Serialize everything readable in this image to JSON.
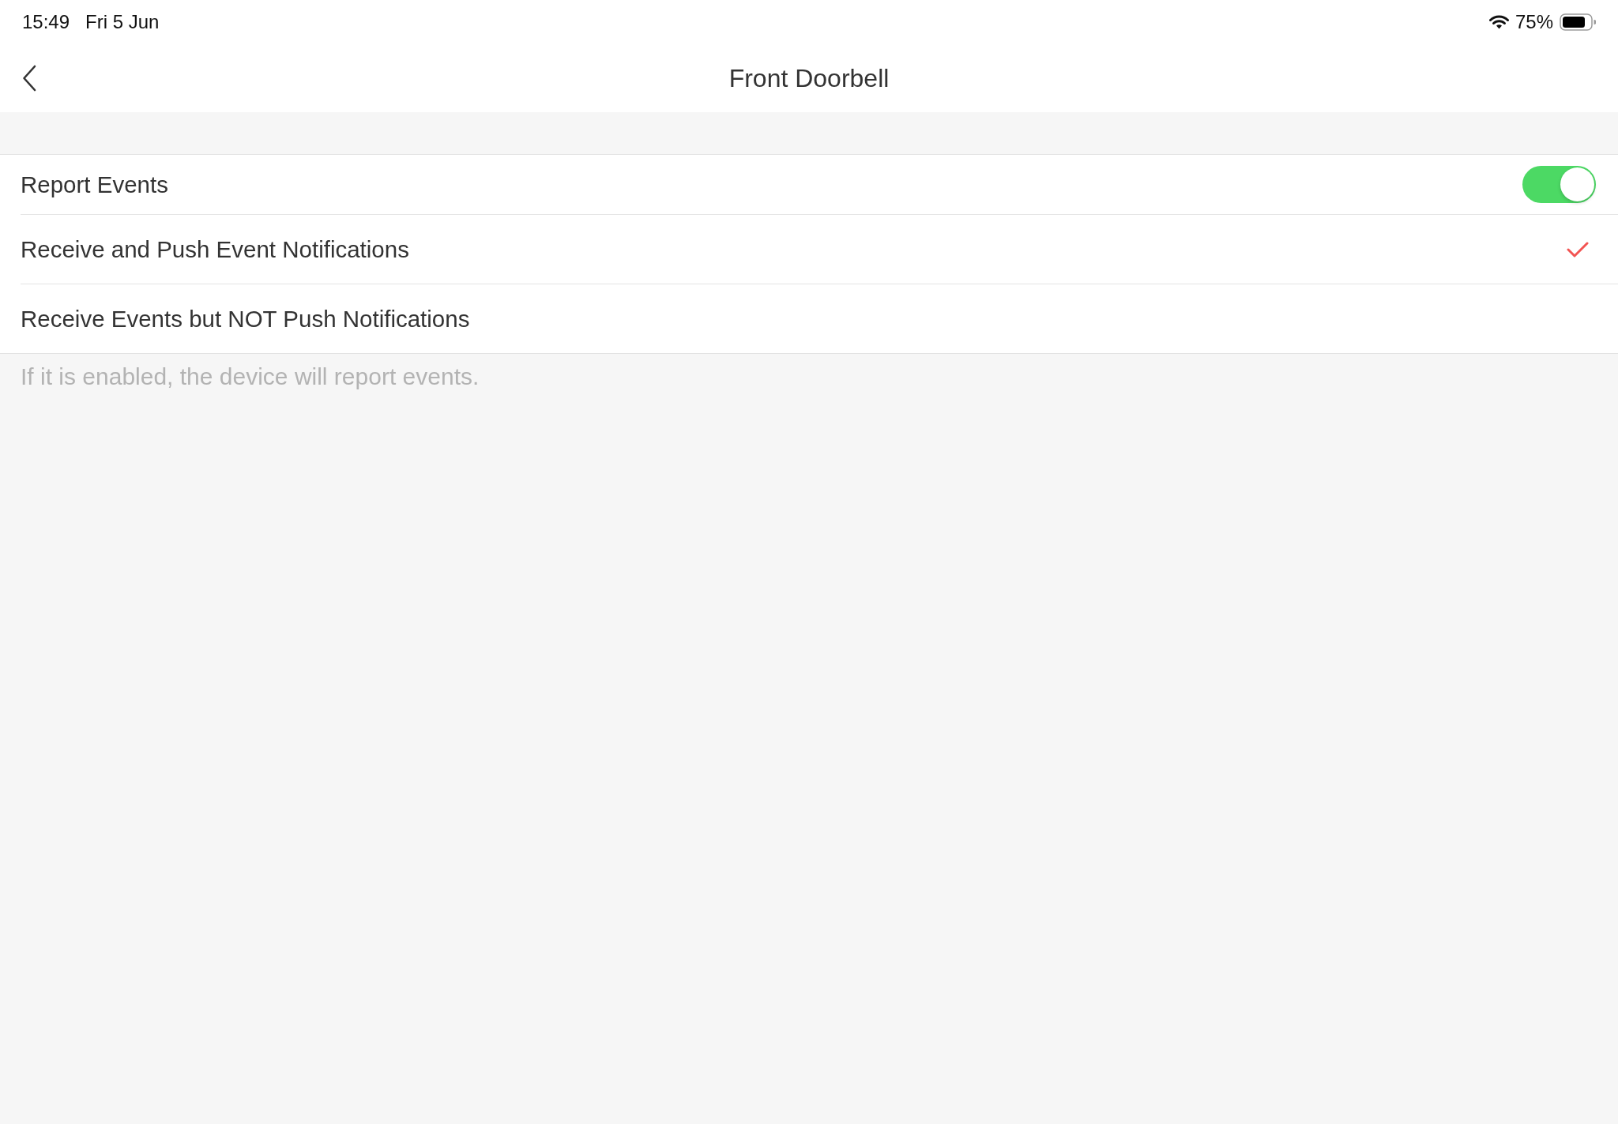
{
  "status_bar": {
    "time": "15:49",
    "date": "Fri 5 Jun",
    "battery_text": "75%"
  },
  "nav_bar": {
    "title": "Front Doorbell"
  },
  "settings": [
    {
      "kind": "toggle",
      "label": "Report Events",
      "on": true
    },
    {
      "kind": "option",
      "label": "Receive and Push Event Notifications",
      "selected": true
    },
    {
      "kind": "option",
      "label": "Receive Events but NOT Push Notifications",
      "selected": false
    }
  ],
  "footer_note": "If it is enabled, the device will report events."
}
